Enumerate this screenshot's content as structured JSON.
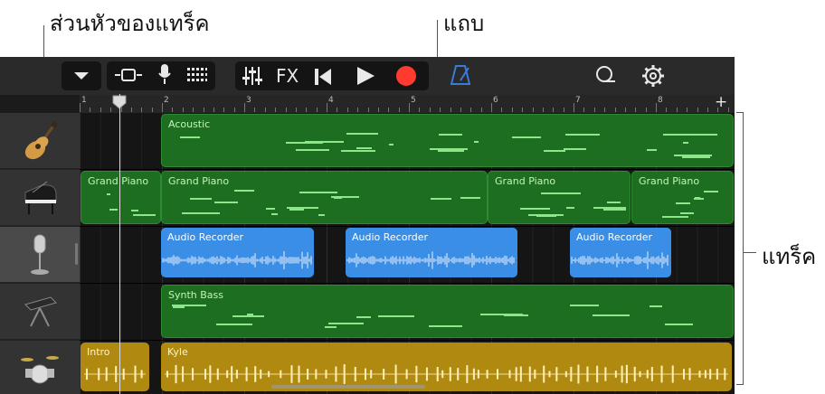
{
  "callouts": {
    "track_header": "ส่วนหัวของแทร็ค",
    "region": "แถบ",
    "tracks": "แทร็ค"
  },
  "toolbar": {
    "fx_label": "FX"
  },
  "ruler": {
    "bars": [
      "1",
      "2",
      "3",
      "4",
      "5",
      "6",
      "7",
      "8"
    ],
    "add_label": "+"
  },
  "tracks": [
    {
      "instrument_icon": "acoustic-guitar-icon",
      "regions": [
        {
          "name": "Acoustic"
        }
      ]
    },
    {
      "instrument_icon": "grand-piano-icon",
      "regions": [
        {
          "name": "Grand Piano"
        },
        {
          "name": "Grand Piano"
        },
        {
          "name": "Grand Piano"
        },
        {
          "name": "Grand Piano"
        }
      ]
    },
    {
      "instrument_icon": "microphone-icon",
      "selected": true,
      "regions": [
        {
          "name": "Audio Recorder"
        },
        {
          "name": "Audio Recorder"
        },
        {
          "name": "Audio Recorder"
        }
      ]
    },
    {
      "instrument_icon": "synth-keyboard-icon",
      "regions": [
        {
          "name": "Synth Bass"
        }
      ]
    },
    {
      "instrument_icon": "drum-kit-icon",
      "regions": [
        {
          "name": "Intro"
        },
        {
          "name": "Kyle"
        }
      ]
    }
  ],
  "colors": {
    "midi_region": "#1e6e22",
    "audio_region": "#3b8ee6",
    "drummer_region": "#b08a10",
    "record_button": "#ff3b30",
    "metronome_active": "#3a7bd5"
  }
}
